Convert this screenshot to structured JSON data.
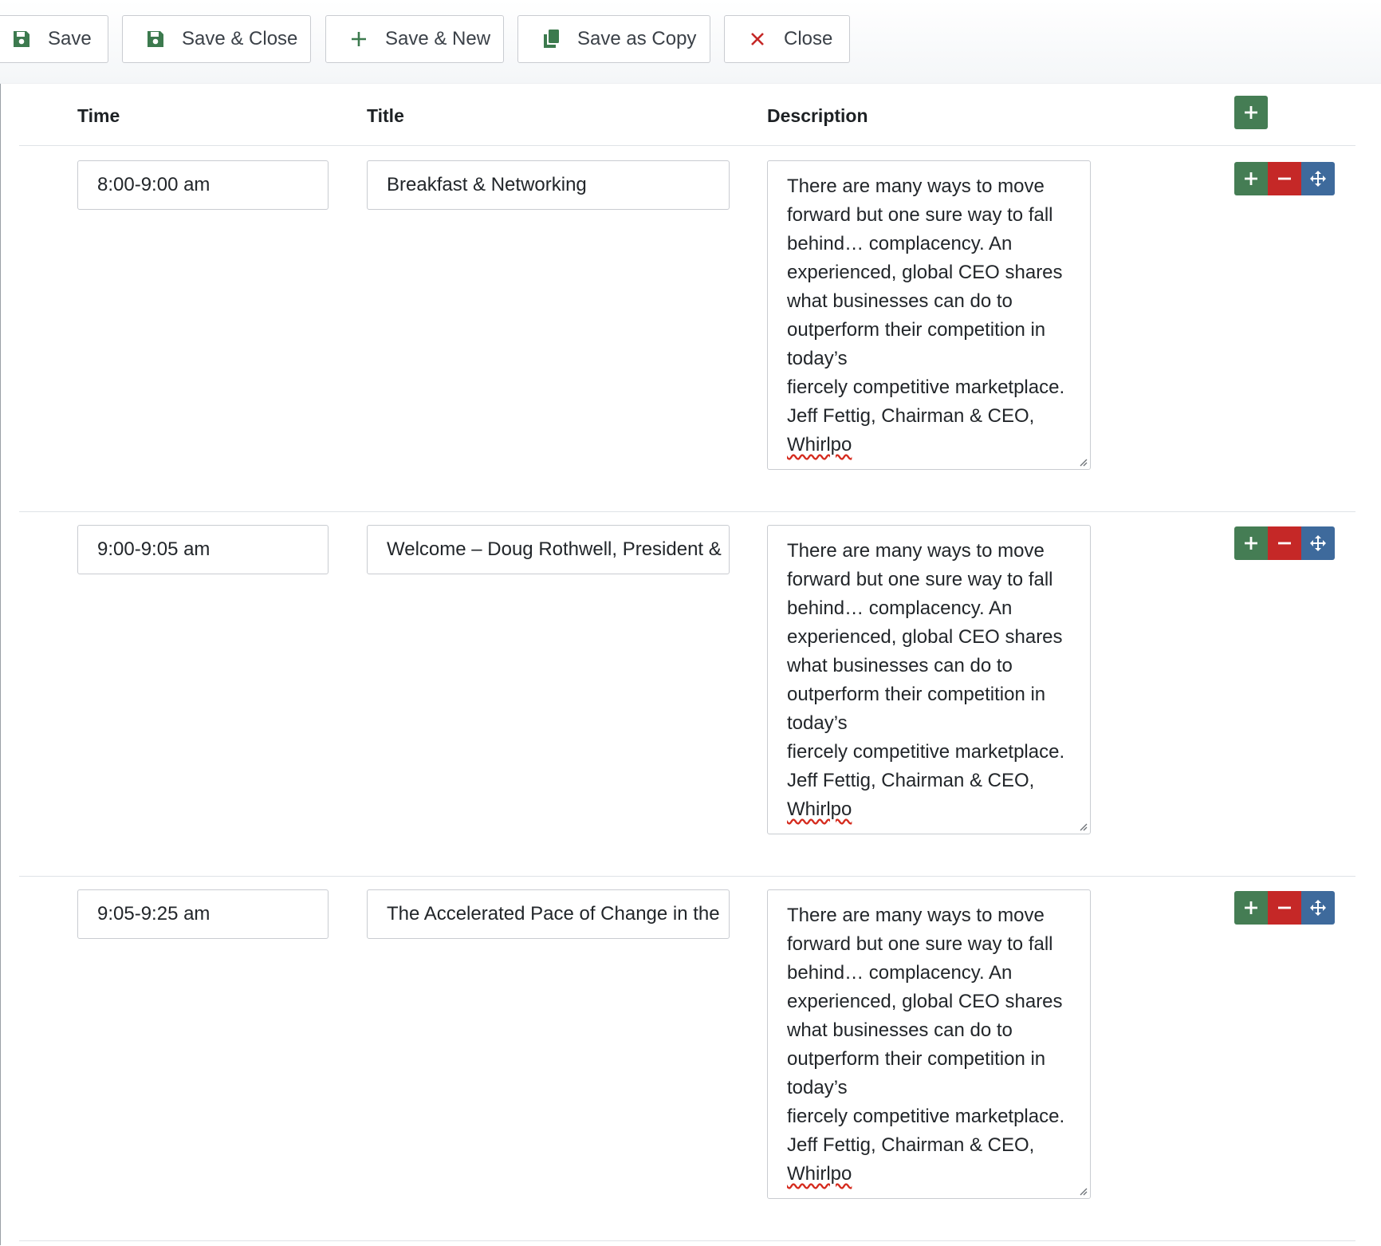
{
  "toolbar": {
    "save": "Save",
    "save_close": "Save & Close",
    "save_new": "Save & New",
    "save_copy": "Save as Copy",
    "close": "Close"
  },
  "columns": {
    "time": "Time",
    "title": "Title",
    "description": "Description"
  },
  "rows": [
    {
      "time": "8:00-9:00 am",
      "title": "Breakfast & Networking",
      "description": [
        "There are many ways to move",
        "forward but one sure way to fall",
        "behind… complacency. An",
        "experienced, global CEO shares",
        "what businesses can do to",
        "outperform their competition in",
        "today’s",
        "fiercely competitive marketplace.",
        "Jeff Fettig, Chairman & CEO,",
        "Whirlpo"
      ]
    },
    {
      "time": "9:00-9:05 am",
      "title": "Welcome – Doug Rothwell, President &",
      "description": [
        "There are many ways to move",
        "forward but one sure way to fall",
        "behind… complacency. An",
        "experienced, global CEO shares",
        "what businesses can do to",
        "outperform their competition in",
        "today’s",
        "fiercely competitive marketplace.",
        "Jeff Fettig, Chairman & CEO,",
        "Whirlpo"
      ]
    },
    {
      "time": "9:05-9:25 am",
      "title": "The Accelerated Pace of Change in the",
      "description": [
        "There are many ways to move",
        "forward but one sure way to fall",
        "behind… complacency. An",
        "experienced, global CEO shares",
        "what businesses can do to",
        "outperform their competition in",
        "today’s",
        "fiercely competitive marketplace.",
        "Jeff Fettig, Chairman & CEO,",
        "Whirlpo"
      ]
    }
  ],
  "colors": {
    "add": "#457d54",
    "remove": "#c52827",
    "move": "#3e6a9c",
    "close_icon": "#c52827"
  },
  "icons": {
    "save": "floppy-disk-icon",
    "save_new": "plus-icon",
    "save_copy": "copy-icon",
    "close": "x-icon",
    "add": "plus-icon",
    "remove": "minus-icon",
    "move": "move-arrows-icon"
  }
}
